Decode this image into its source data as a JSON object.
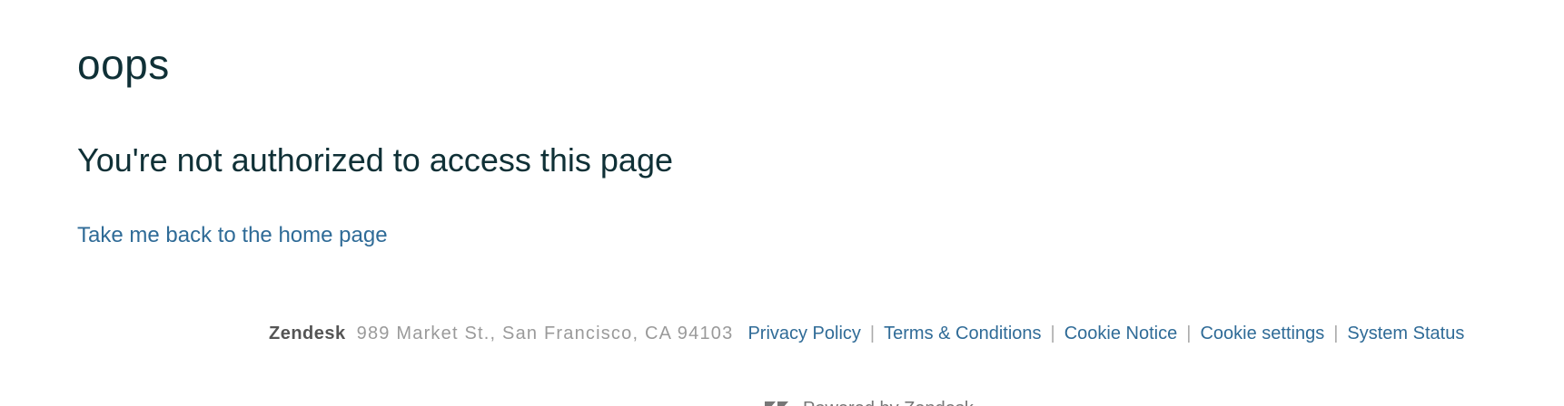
{
  "error": {
    "heading": "oops",
    "message": "You're not authorized to access this page",
    "home_link": "Take me back to the home page"
  },
  "footer": {
    "brand": "Zendesk",
    "address": "989 Market St., San Francisco, CA 94103",
    "links": [
      "Privacy Policy",
      "Terms & Conditions",
      "Cookie Notice",
      "Cookie settings",
      "System Status"
    ],
    "separator": "|",
    "powered_by": "Powered by Zendesk"
  },
  "colors": {
    "heading": "#0f3036",
    "link": "#2f6b97",
    "address": "#9a9a9a",
    "brand": "#555555"
  },
  "icons": {
    "powered_by": "zendesk-logo-icon"
  }
}
